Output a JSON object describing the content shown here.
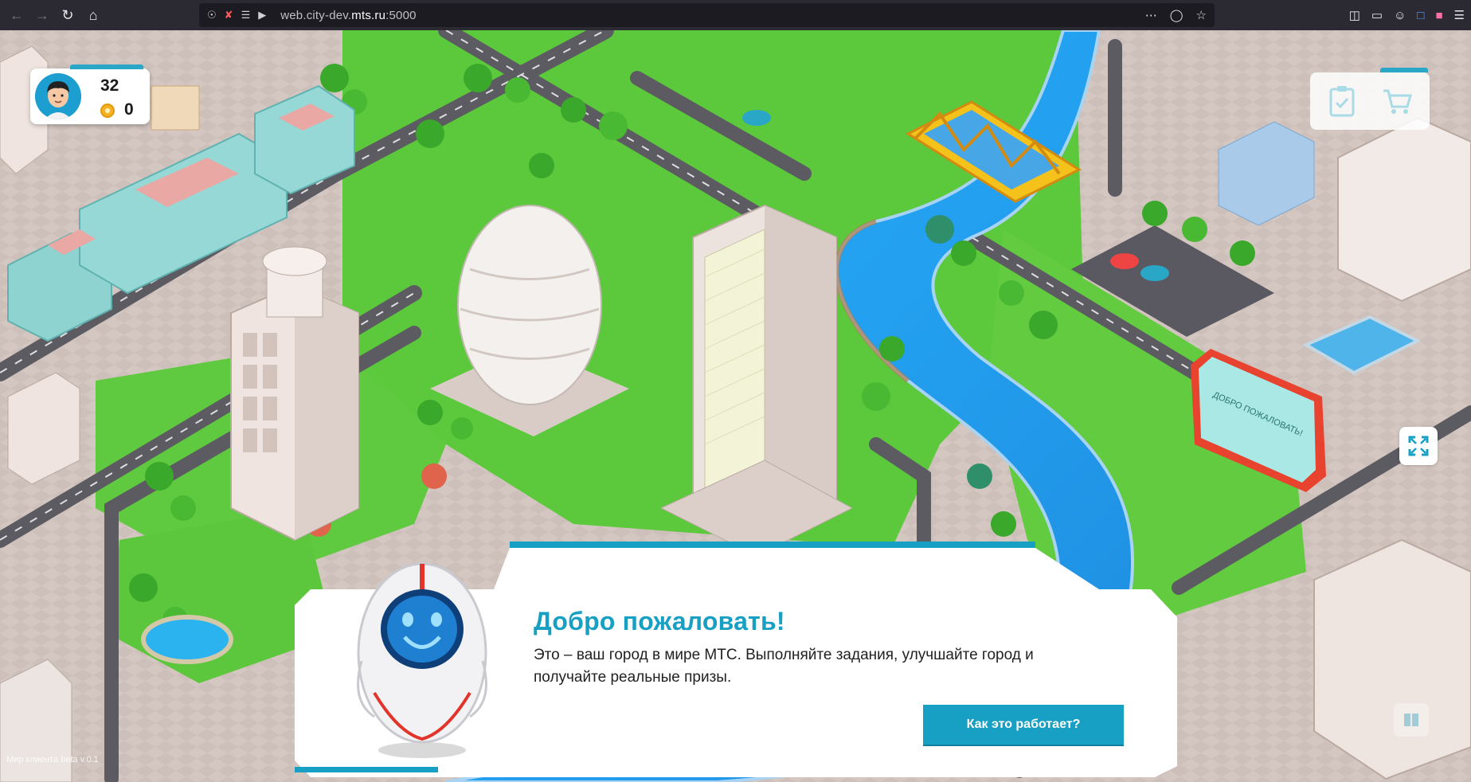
{
  "browser": {
    "url_prefix": "web.city-dev.",
    "url_domain": "mts.ru",
    "url_suffix": ":5000",
    "icons": [
      "back-arrow-icon",
      "forward-arrow-icon",
      "reload-icon",
      "home-icon",
      "shield-icon",
      "overflow-dots-icon",
      "pocket-icon",
      "star-icon",
      "library-icon",
      "sidebar-icon",
      "account-icon",
      "translate-icon",
      "extension-icon",
      "hamburger-menu-icon"
    ]
  },
  "hud": {
    "level": "32",
    "coins": "0",
    "accent_color": "#2aa7c7"
  },
  "welcome": {
    "title": "Добро пожаловать!",
    "text": "Это – ваш город в мире МТС. Выполняйте задания, улучшайте город и получайте реальные призы.",
    "button_label": "Как это работает?",
    "accent_color": "#17a0c4"
  },
  "billboard": {
    "text": "ДОБРО ПОЖАЛОВАТЬ!"
  },
  "footer": {
    "version": "Мир клиента beta v.0.1"
  }
}
